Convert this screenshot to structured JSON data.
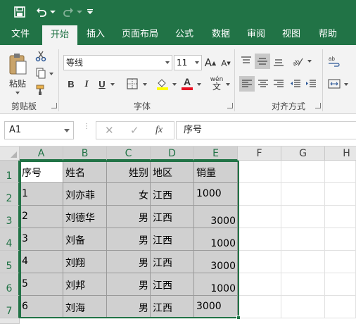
{
  "quick_access": {
    "save_icon": "save-icon",
    "undo_icon": "undo-icon",
    "redo_icon": "redo-icon",
    "customize_icon": "customize-qat-icon"
  },
  "tabs": [
    {
      "label": "文件"
    },
    {
      "label": "开始",
      "active": true
    },
    {
      "label": "插入"
    },
    {
      "label": "页面布局"
    },
    {
      "label": "公式"
    },
    {
      "label": "数据"
    },
    {
      "label": "审阅"
    },
    {
      "label": "视图"
    },
    {
      "label": "帮助"
    }
  ],
  "ribbon": {
    "clipboard": {
      "paste_label": "粘贴",
      "group_label": "剪贴板"
    },
    "font": {
      "font_name": "等线",
      "font_size": "11",
      "group_label": "字体",
      "bold": "B",
      "italic": "I",
      "underline": "U",
      "grow": "A",
      "shrink": "A",
      "color_letter": "A",
      "phonetic": "wén"
    },
    "alignment": {
      "group_label": "对齐方式"
    },
    "accent_color": "#217346",
    "font_color": "#e81123",
    "fill_color": "#ffff00"
  },
  "formula_bar": {
    "name_box": "A1",
    "fx_label": "fx",
    "content": "序号"
  },
  "grid": {
    "columns": [
      "A",
      "B",
      "C",
      "D",
      "E",
      "F",
      "G",
      "H"
    ],
    "rows": [
      "1",
      "2",
      "3",
      "4",
      "5",
      "6",
      "7"
    ],
    "data": [
      [
        "序号",
        "姓名",
        "姓别",
        "地区",
        "销量"
      ],
      [
        "1",
        "刘亦菲",
        "女",
        "江西",
        "1000"
      ],
      [
        "2",
        "刘德华",
        "男",
        "江西",
        "3000"
      ],
      [
        "3",
        "刘备",
        "男",
        "江西",
        "1000"
      ],
      [
        "4",
        "刘翔",
        "男",
        "江西",
        "3000"
      ],
      [
        "5",
        "刘邦",
        "男",
        "江西",
        "1000"
      ],
      [
        "6",
        "刘海",
        "男",
        "江西",
        "3000"
      ]
    ]
  }
}
